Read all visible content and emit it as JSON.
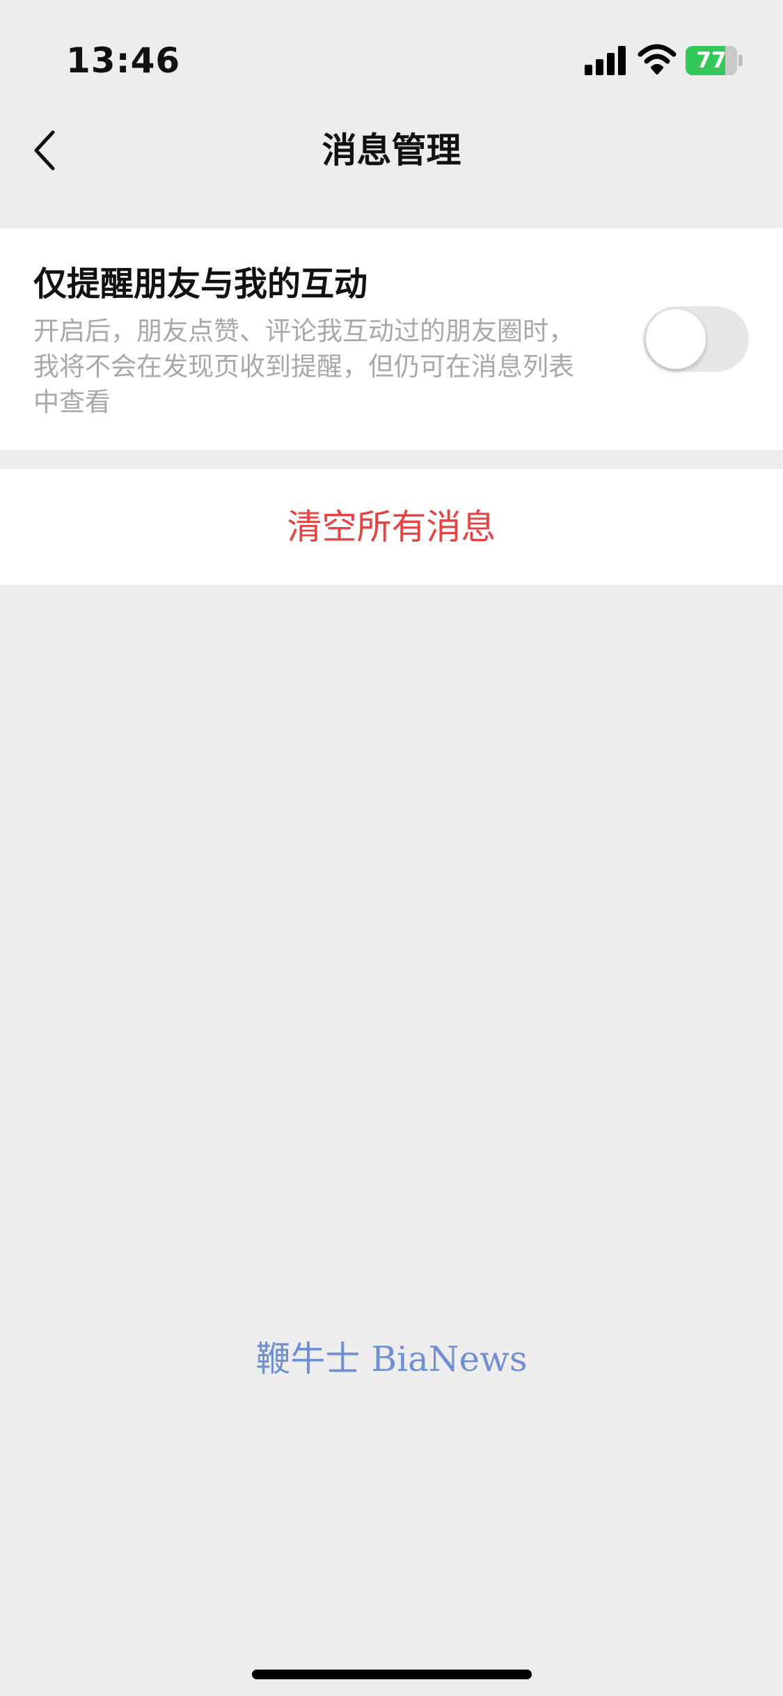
{
  "status_bar": {
    "time": "13:46",
    "signal_icon": "signal-bars-icon",
    "wifi_icon": "wifi-icon",
    "battery_level": "77",
    "battery_color": "#34c759",
    "battery_charging_icon": "lightning-icon"
  },
  "nav": {
    "back_icon": "chevron-left-icon",
    "title": "消息管理"
  },
  "setting": {
    "title": "仅提醒朋友与我的互动",
    "description": "开启后，朋友点赞、评论我互动过的朋友圈时，我将不会在发现页收到提醒，但仍可在消息列表中查看",
    "toggle_on": false
  },
  "actions": {
    "clear_all_label": "清空所有消息",
    "clear_color": "#e84343"
  },
  "watermark": {
    "text": "鞭牛士 BiaNews"
  }
}
